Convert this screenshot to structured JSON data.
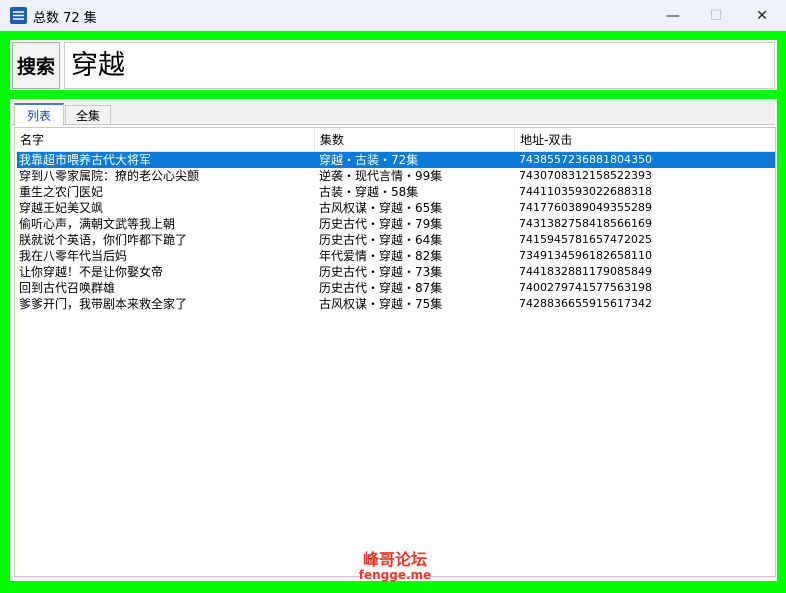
{
  "window": {
    "title": "总数 72 集",
    "minimize_glyph": "—",
    "maximize_glyph": "☐",
    "close_glyph": "✕"
  },
  "search": {
    "button_label": "搜索",
    "value": "穿越"
  },
  "tabs": [
    {
      "label": "列表",
      "selected": true
    },
    {
      "label": "全集",
      "selected": false
    }
  ],
  "table": {
    "columns": [
      "名字",
      "集数",
      "地址-双击"
    ],
    "rows": [
      {
        "name": "我靠超市喂养古代大将军",
        "episodes": "穿越・古装・72集",
        "address": "7438557236881804350",
        "selected": true
      },
      {
        "name": "穿到八零家属院：撩的老公心尖颤",
        "episodes": "逆袭・现代言情・99集",
        "address": "7430708312158522393"
      },
      {
        "name": "重生之农门医妃",
        "episodes": "古装・穿越・58集",
        "address": "7441103593022688318"
      },
      {
        "name": "穿越王妃美又飒",
        "episodes": "古风权谋・穿越・65集",
        "address": "7417760389049355289"
      },
      {
        "name": "偷听心声，满朝文武等我上朝",
        "episodes": "历史古代・穿越・79集",
        "address": "7431382758418566169"
      },
      {
        "name": "朕就说个英语，你们咋都下跪了",
        "episodes": "历史古代・穿越・64集",
        "address": "7415945781657472025"
      },
      {
        "name": "我在八零年代当后妈",
        "episodes": "年代爱情・穿越・82集",
        "address": "7349134596182658110"
      },
      {
        "name": "让你穿越！不是让你娶女帝",
        "episodes": "历史古代・穿越・73集",
        "address": "7441832881179085849"
      },
      {
        "name": "回到古代召唤群雄",
        "episodes": "历史古代・穿越・87集",
        "address": "7400279741577563198"
      },
      {
        "name": "爹爹开门，我带剧本来救全家了",
        "episodes": "古风权谋・穿越・75集",
        "address": "7428836655915617342"
      }
    ]
  },
  "watermark": {
    "title": "峰哥论坛",
    "url": "fengge.me"
  },
  "colors": {
    "frame": "#00ff00",
    "selection": "#0a7bd6",
    "watermark": "#e83a2a"
  }
}
